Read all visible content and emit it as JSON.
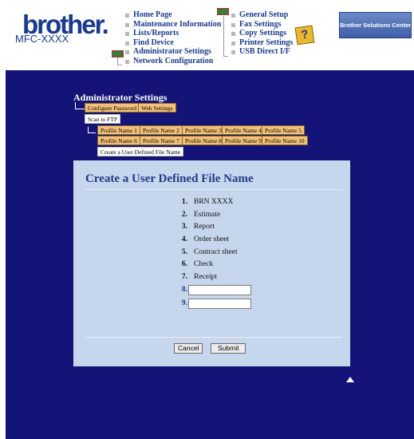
{
  "header": {
    "logo": "brother.",
    "model": "MFC-XXXX",
    "help_symbol": "?",
    "solutions_center": "Brother Solutions Center"
  },
  "nav": {
    "left": [
      "Home Page",
      "Maintenance Information",
      "Lists/Reports",
      "Find Device",
      "Administrator Settings",
      "Network Configuration"
    ],
    "right": [
      "General Setup",
      "Fax Settings",
      "Copy Settings",
      "Printer Settings",
      "USB Direct I/F"
    ]
  },
  "admin": {
    "title": "Administrator Settings",
    "tabs": [
      "Configure Password",
      "Web Settings"
    ],
    "scan_to_ftp": "Scan to FTP",
    "profiles_row1": [
      "Profile Name 1",
      "Profile Name 2",
      "Profile Name 3",
      "Profile Name 4",
      "Profile Name 5"
    ],
    "profiles_row2": [
      "Profile Name 6",
      "Profile Name 7",
      "Profile Name 8",
      "Profile Name 9",
      "Profile Name 10"
    ],
    "user_defined_tab": "Create a User Defined File Name"
  },
  "panel": {
    "title": "Create a User Defined File Name",
    "items": [
      {
        "num": "1.",
        "text": "BRN XXXX"
      },
      {
        "num": "2.",
        "text": "Estimate"
      },
      {
        "num": "3.",
        "text": "Report"
      },
      {
        "num": "4.",
        "text": "Order sheet"
      },
      {
        "num": "5.",
        "text": "Contract sheet"
      },
      {
        "num": "6.",
        "text": "Check"
      },
      {
        "num": "7.",
        "text": "Receipt"
      }
    ],
    "input_items": [
      {
        "num": "8.",
        "value": ""
      },
      {
        "num": "9.",
        "value": ""
      }
    ],
    "cancel_label": "Cancel",
    "submit_label": "Submit"
  },
  "colors": {
    "main_bg": "#141478",
    "panel_bg": "#c6d6ec",
    "tab_orange": "#f2c078",
    "title_blue": "#223a8a"
  }
}
